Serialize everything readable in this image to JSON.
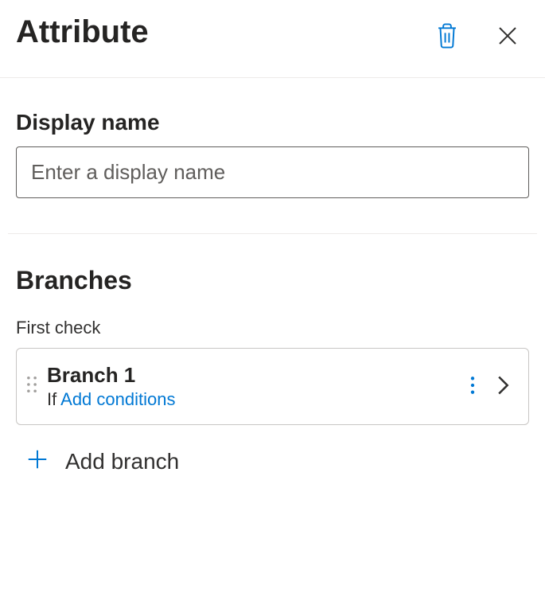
{
  "header": {
    "title": "Attribute"
  },
  "display_name": {
    "label": "Display name",
    "placeholder": "Enter a display name",
    "value": ""
  },
  "branches": {
    "heading": "Branches",
    "first_check_label": "First check",
    "items": [
      {
        "name": "Branch 1",
        "if_prefix": "If",
        "condition_link": "Add conditions"
      }
    ],
    "add_label": "Add branch"
  },
  "colors": {
    "accent": "#0078d4"
  }
}
